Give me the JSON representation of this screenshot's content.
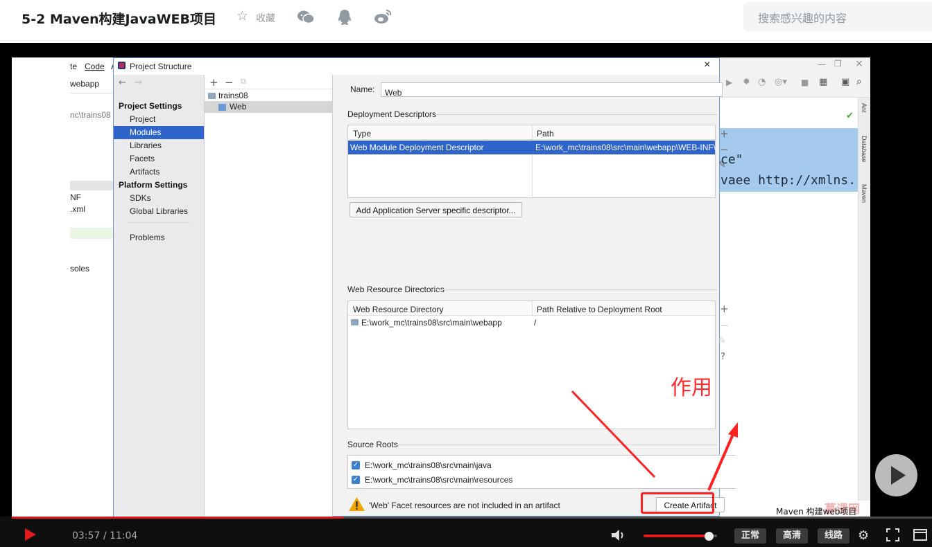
{
  "header": {
    "title": "5-2 Maven构建JavaWEB项目",
    "favorite_label": "收藏",
    "search_placeholder": "搜索感兴趣的内容"
  },
  "ide": {
    "menu_items": [
      "te",
      "Code",
      "A"
    ],
    "project_label": "webapp",
    "path_fragment": "nc\\trains08",
    "tree_fragments": [
      "NF",
      ".xml",
      "soles"
    ],
    "code_lines": [
      "ce\"",
      "vaee http://xmlns."
    ],
    "side_tabs": [
      "Ant",
      "Database",
      "Maven"
    ]
  },
  "dialog": {
    "title": "Project Structure",
    "close": "×",
    "nav": {
      "project_settings": "Project Settings",
      "project_items": [
        "Project",
        "Modules",
        "Libraries",
        "Facets",
        "Artifacts"
      ],
      "platform_settings": "Platform Settings",
      "platform_items": [
        "SDKs",
        "Global Libraries"
      ],
      "problems": "Problems",
      "selected": "Modules"
    },
    "tree": {
      "root": "trains08",
      "child": "Web"
    },
    "name_label": "Name:",
    "name_value": "Web",
    "deployment": {
      "title": "Deployment Descriptors",
      "columns": [
        "Type",
        "Path"
      ],
      "rows": [
        {
          "type": "Web Module Deployment Descriptor",
          "path": "E:\\work_mc\\trains08\\src\\main\\webapp\\WEB-INF\\"
        }
      ],
      "add_button": "Add Application Server specific descriptor..."
    },
    "resources": {
      "title": "Web Resource Directories",
      "columns": [
        "Web Resource Directory",
        "Path Relative to Deployment Root"
      ],
      "rows": [
        {
          "dir": "E:\\work_mc\\trains08\\src\\main\\webapp",
          "path": "/"
        }
      ]
    },
    "source_roots": {
      "title": "Source Roots",
      "items": [
        "E:\\work_mc\\trains08\\src\\main\\java",
        "E:\\work_mc\\trains08\\src\\main\\resources"
      ]
    },
    "warning": "'Web' Facet resources are not included in an artifact",
    "create_artifact": "Create Artifact"
  },
  "annotation": {
    "text": "作用",
    "color": "#ff2a2a"
  },
  "watermark": {
    "brand": "慕课网",
    "caption": "Maven 构建web项目"
  },
  "player": {
    "time_current": "03:57",
    "time_separator": "/",
    "time_total": "11:04",
    "progress_fraction": 0.36,
    "volume_fraction": 0.9,
    "buttons": [
      "正常",
      "高清",
      "线路"
    ],
    "accent": "#e21a1a"
  }
}
